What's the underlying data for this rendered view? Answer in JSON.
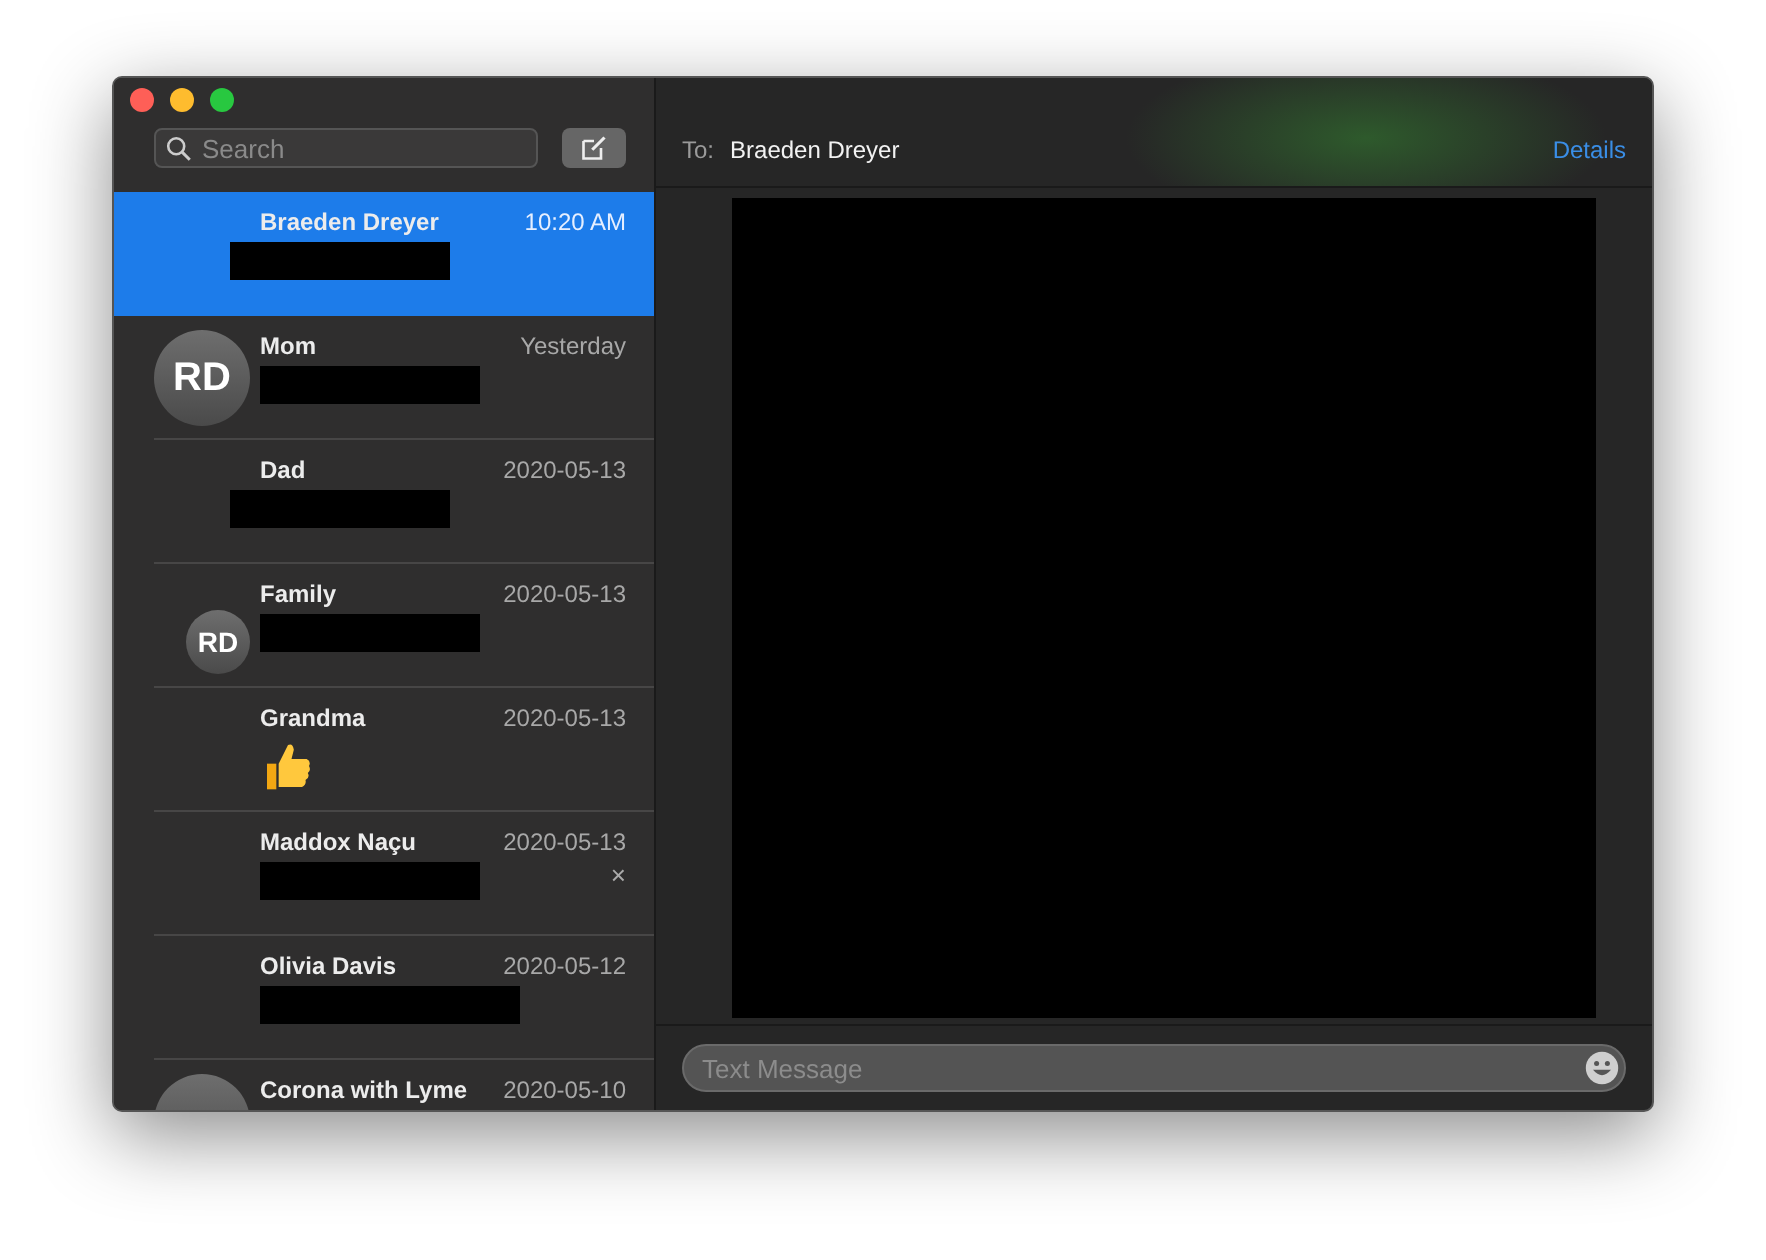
{
  "sidebar": {
    "search": {
      "placeholder": "Search"
    },
    "conversations": [
      {
        "name": "Braeden Dreyer",
        "time": "10:20 AM",
        "selected": true,
        "preview": {
          "kind": "redacted"
        }
      },
      {
        "name": "Mom",
        "time": "Yesterday",
        "selected": false,
        "preview": {
          "kind": "redacted"
        },
        "avatar": {
          "kind": "large",
          "initials": "RD"
        }
      },
      {
        "name": "Dad",
        "time": "2020-05-13",
        "selected": false,
        "preview": {
          "kind": "redacted"
        }
      },
      {
        "name": "Family",
        "time": "2020-05-13",
        "selected": false,
        "preview": {
          "kind": "redacted"
        },
        "avatar": {
          "kind": "small",
          "initials": "RD"
        }
      },
      {
        "name": "Grandma",
        "time": "2020-05-13",
        "selected": false,
        "preview": {
          "kind": "thumbs"
        }
      },
      {
        "name": "Maddox Naçu",
        "time": "2020-05-13",
        "selected": false,
        "preview": {
          "kind": "redacted"
        },
        "close_mark": "×"
      },
      {
        "name": "Olivia Davis",
        "time": "2020-05-12",
        "selected": false,
        "preview": {
          "kind": "redacted"
        }
      },
      {
        "name": "Corona with Lyme",
        "time": "2020-05-10",
        "selected": false,
        "avatar": {
          "kind": "large"
        }
      }
    ]
  },
  "header": {
    "to_label": "To:",
    "recipient": "Braeden Dreyer",
    "details": "Details"
  },
  "composer": {
    "placeholder": "Text Message"
  }
}
